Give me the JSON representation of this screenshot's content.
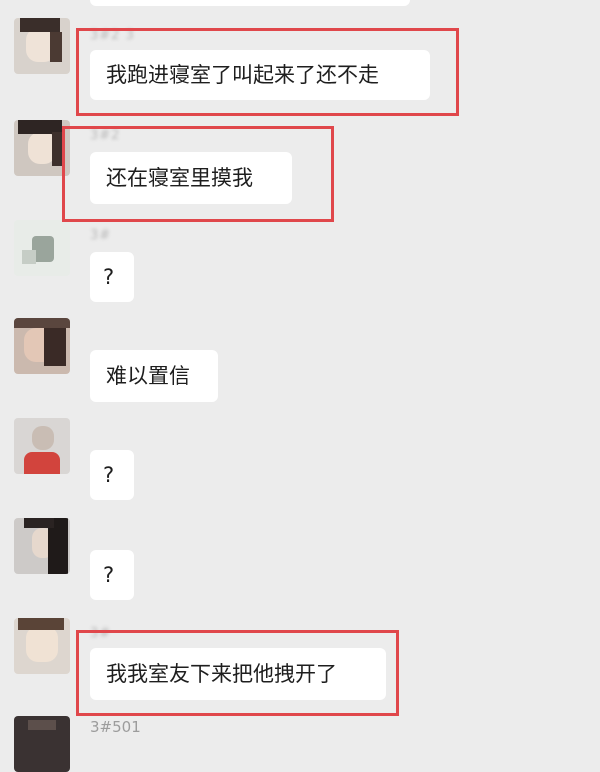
{
  "messages": [
    {
      "sender": "3#2 3",
      "text": "我跑进寝室了叫起来了还不走",
      "highlighted": true
    },
    {
      "sender": "3#2",
      "text": "还在寝室里摸我",
      "highlighted": true
    },
    {
      "sender": "3#",
      "text": "?",
      "highlighted": false
    },
    {
      "sender": "",
      "text": "难以置信",
      "highlighted": false
    },
    {
      "sender": "",
      "text": "?",
      "highlighted": false
    },
    {
      "sender": "",
      "text": "?",
      "highlighted": false
    },
    {
      "sender": "3#",
      "text": "我我室友下来把他拽开了",
      "highlighted": true
    },
    {
      "sender": "3#501",
      "text": "",
      "highlighted": false
    }
  ],
  "colors": {
    "background": "#ececec",
    "bubble": "#ffffff",
    "highlight": "#e0474b"
  }
}
